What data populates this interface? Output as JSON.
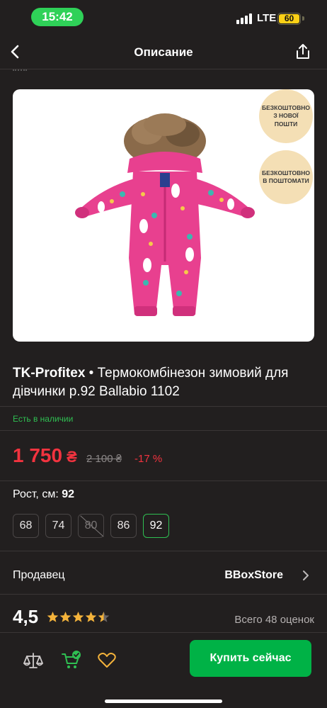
{
  "status_bar": {
    "time": "15:42",
    "network": "LTE",
    "battery": "60"
  },
  "nav": {
    "title": "Описание"
  },
  "badges": {
    "nova_poshta": "БЕЗКОШТОВНО З НОВОЇ ПОШТИ",
    "postomat": "БЕЗКОШТОВНО В ПОШТОМАТИ"
  },
  "product": {
    "brand": "TK-Profitex",
    "separator": " • ",
    "name": "Термокомбінезон зимовий для дівчинки р.92 Ballabio 1102",
    "stock": "Есть в наличии"
  },
  "price": {
    "current": "1 750",
    "currency": "₴",
    "old": "2 100 ₴",
    "discount": "-17 %"
  },
  "size": {
    "label": "Рост, см:",
    "selected": "92",
    "options": [
      "68",
      "74",
      "80",
      "86",
      "92"
    ]
  },
  "seller": {
    "label": "Продавец",
    "name": "BBoxStore"
  },
  "rating": {
    "value": "4,5",
    "stars": 4.5,
    "count": "Всего 48 оценок"
  },
  "actions": {
    "buy": "Купить сейчас"
  },
  "colors": {
    "accent": "#00b246",
    "price": "#f2333f",
    "stock": "#2fbf52",
    "background": "#221f1f"
  },
  "icons": [
    "back-icon",
    "share-icon",
    "compare-icon",
    "cart-check-icon",
    "heart-icon",
    "chevron-right-icon",
    "star-icon"
  ]
}
